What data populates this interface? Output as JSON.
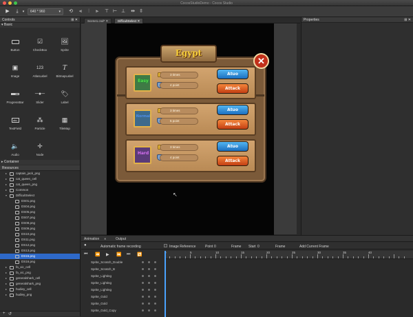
{
  "window": {
    "title": "CocosStudioDemo - Cocos Studio"
  },
  "toolbar": {
    "resolution": "640 * 960"
  },
  "controls": {
    "header": "Controls",
    "basic_label": "Basic",
    "items": [
      "Button",
      "CheckBox",
      "Sprite",
      "Image",
      "AtlasLabel",
      "BitmapLabel",
      "ProgressBar",
      "Slider",
      "Label",
      "TextField",
      "Particle",
      "TileMap",
      "Audio",
      "Node"
    ],
    "container_label": "Container"
  },
  "resources": {
    "header": "Resources",
    "items": [
      {
        "label": "captain_jack_png",
        "type": "folder",
        "level": 1
      },
      {
        "label": "cat_queen_cell",
        "type": "folder",
        "level": 1
      },
      {
        "label": "cat_queen_png",
        "type": "folder",
        "level": 1
      },
      {
        "label": "Common",
        "type": "folder",
        "level": 1
      },
      {
        "label": "DifficultSelect",
        "type": "folder",
        "level": 1,
        "open": true
      },
      {
        "label": "DS01.png",
        "type": "file",
        "level": 2
      },
      {
        "label": "DS04.png",
        "type": "file",
        "level": 2
      },
      {
        "label": "DS05.png",
        "type": "file",
        "level": 2
      },
      {
        "label": "DS07.png",
        "type": "file",
        "level": 2
      },
      {
        "label": "DS08.png",
        "type": "file",
        "level": 2
      },
      {
        "label": "DS09.png",
        "type": "file",
        "level": 2
      },
      {
        "label": "DS10.png",
        "type": "file",
        "level": 2
      },
      {
        "label": "DS11.png",
        "type": "file",
        "level": 2
      },
      {
        "label": "DS12.png",
        "type": "file",
        "level": 2
      },
      {
        "label": "DS13.png",
        "type": "file",
        "level": 2
      },
      {
        "label": "DS15.png",
        "type": "file",
        "level": 2,
        "selected": true
      },
      {
        "label": "DS16.png",
        "type": "file",
        "level": 2
      },
      {
        "label": "fa_xic_cell",
        "type": "folder",
        "level": 1
      },
      {
        "label": "fa_xic_png",
        "type": "folder",
        "level": 1
      },
      {
        "label": "generalshark_cell",
        "type": "folder",
        "level": 1
      },
      {
        "label": "generalshark_png",
        "type": "folder",
        "level": 1
      },
      {
        "label": "hudiey_cell",
        "type": "folder",
        "level": 1
      },
      {
        "label": "hudiey_png",
        "type": "folder",
        "level": 1
      }
    ]
  },
  "doc_tabs": [
    {
      "label": "Scene1.csd*"
    },
    {
      "label": "DifficultSelect"
    }
  ],
  "properties": {
    "header": "Properties"
  },
  "game": {
    "title": "Egypt",
    "rows": [
      {
        "level": "Easy",
        "level_color": "#58d84a",
        "times": "3 times",
        "points": "4 point"
      },
      {
        "level": "Normal",
        "level_color": "#4f8fe8",
        "times": "3 times",
        "points": "5 point"
      },
      {
        "level": "Hard",
        "level_color": "#c65ae0",
        "times": "3 times",
        "points": "4 point"
      }
    ],
    "btn_top": "Atuo",
    "btn_bottom": "Attack"
  },
  "animation": {
    "tabs": [
      "Animation",
      "Output"
    ],
    "auto_record": "Automatic frame recording",
    "image_reference": "Image Reference",
    "point_label": "Point",
    "point_value": "0",
    "frame_label": "Frame",
    "start_label": "Start",
    "start_value": "0",
    "frame_label2": "Frame",
    "add_current_frame": "Add Current Frame",
    "ruler": [
      "0",
      "5",
      "10",
      "15",
      "20",
      "25",
      "30",
      "35",
      "40"
    ],
    "tracks": [
      "Sprite_Scratch_Double",
      "Sprite_Scratch_B",
      "Sprite_Lighting",
      "Sprite_Lighting",
      "Sprite_Lighting",
      "Sprite_Gold",
      "Sprite_Gold",
      "Sprite_Gold_Copy"
    ]
  },
  "colors": {
    "accent": "#2e69c9",
    "panel": "#2d2d2d",
    "btn_blue": "#1c6fbf",
    "btn_red": "#c33f13"
  }
}
